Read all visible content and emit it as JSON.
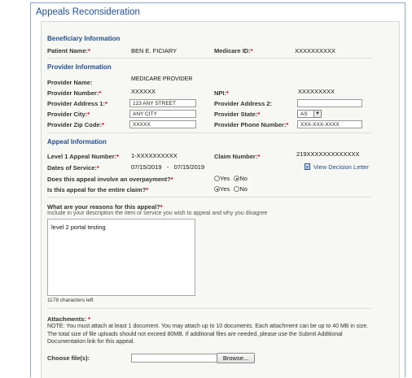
{
  "page": {
    "title": "Appeals Reconsideration"
  },
  "beneficiary": {
    "heading": "Beneficiary Information",
    "patient_name_label": "Patient Name:",
    "patient_name": "BEN E. FICIARY",
    "medicare_id_label": "Medicare ID:",
    "medicare_id": "XXXXXXXXXX"
  },
  "provider": {
    "heading": "Provider Information",
    "name_label": "Provider Name:",
    "name": "MEDICARE PROVIDER",
    "number_label": "Provider Number:",
    "number": "XXXXXX",
    "npi_label": "NPI:",
    "npi": "XXXXXXXXX",
    "address1_label": "Provider Address 1:",
    "address1": "123 ANY STREET",
    "address2_label": "Provider Address 2:",
    "address2": "",
    "city_label": "Provider City:",
    "city": "ANY CITY",
    "state_label": "Provider State:",
    "state": "AS",
    "zip_label": "Provider Zip Code:",
    "zip": "XXXXX",
    "phone_label": "Provider Phone Number:",
    "phone": "XXX-XXX-XXXX"
  },
  "appeal": {
    "heading": "Appeal Information",
    "level1_label": "Level 1 Appeal Number:",
    "level1": "1-XXXXXXXXXX",
    "claim_label": "Claim Number:",
    "claim": "219XXXXXXXXXXXXX",
    "dates_label": "Dates of Service:",
    "date_from": "07/15/2019",
    "date_sep": "-",
    "date_to": "07/15/2019",
    "view_decision": "View Decision Letter",
    "overpayment_q": "Does this appeal involve an overpayment?",
    "entire_claim_q": "Is this appeal for the entire claim?",
    "yes": "Yes",
    "no": "No",
    "overpayment_selected": "No",
    "entire_claim_selected": "Yes",
    "reasons_q": "What are your reasons for this appeal?",
    "reasons_hint": "Include in your description the item or service you wish to appeal and why you disagree",
    "reasons_text": "level 2 portal testing",
    "chars_left": "1178 characters left"
  },
  "attachments": {
    "label": "Attachments:",
    "note": "NOTE: You must attach at least 1 document. You may attach up to 10 documents. Each attachment can be up to 40 MB in size. The total size of file uploads should not exceed 80MB. If additional files are needed, please use the Submit Additional Documentation link for this appeal.",
    "choose_label": "Choose file(s):",
    "browse_label": "Browse..."
  },
  "colors": {
    "heading": "#1f4e8c",
    "required": "#d0021b",
    "panel": "#f7f7f3"
  }
}
